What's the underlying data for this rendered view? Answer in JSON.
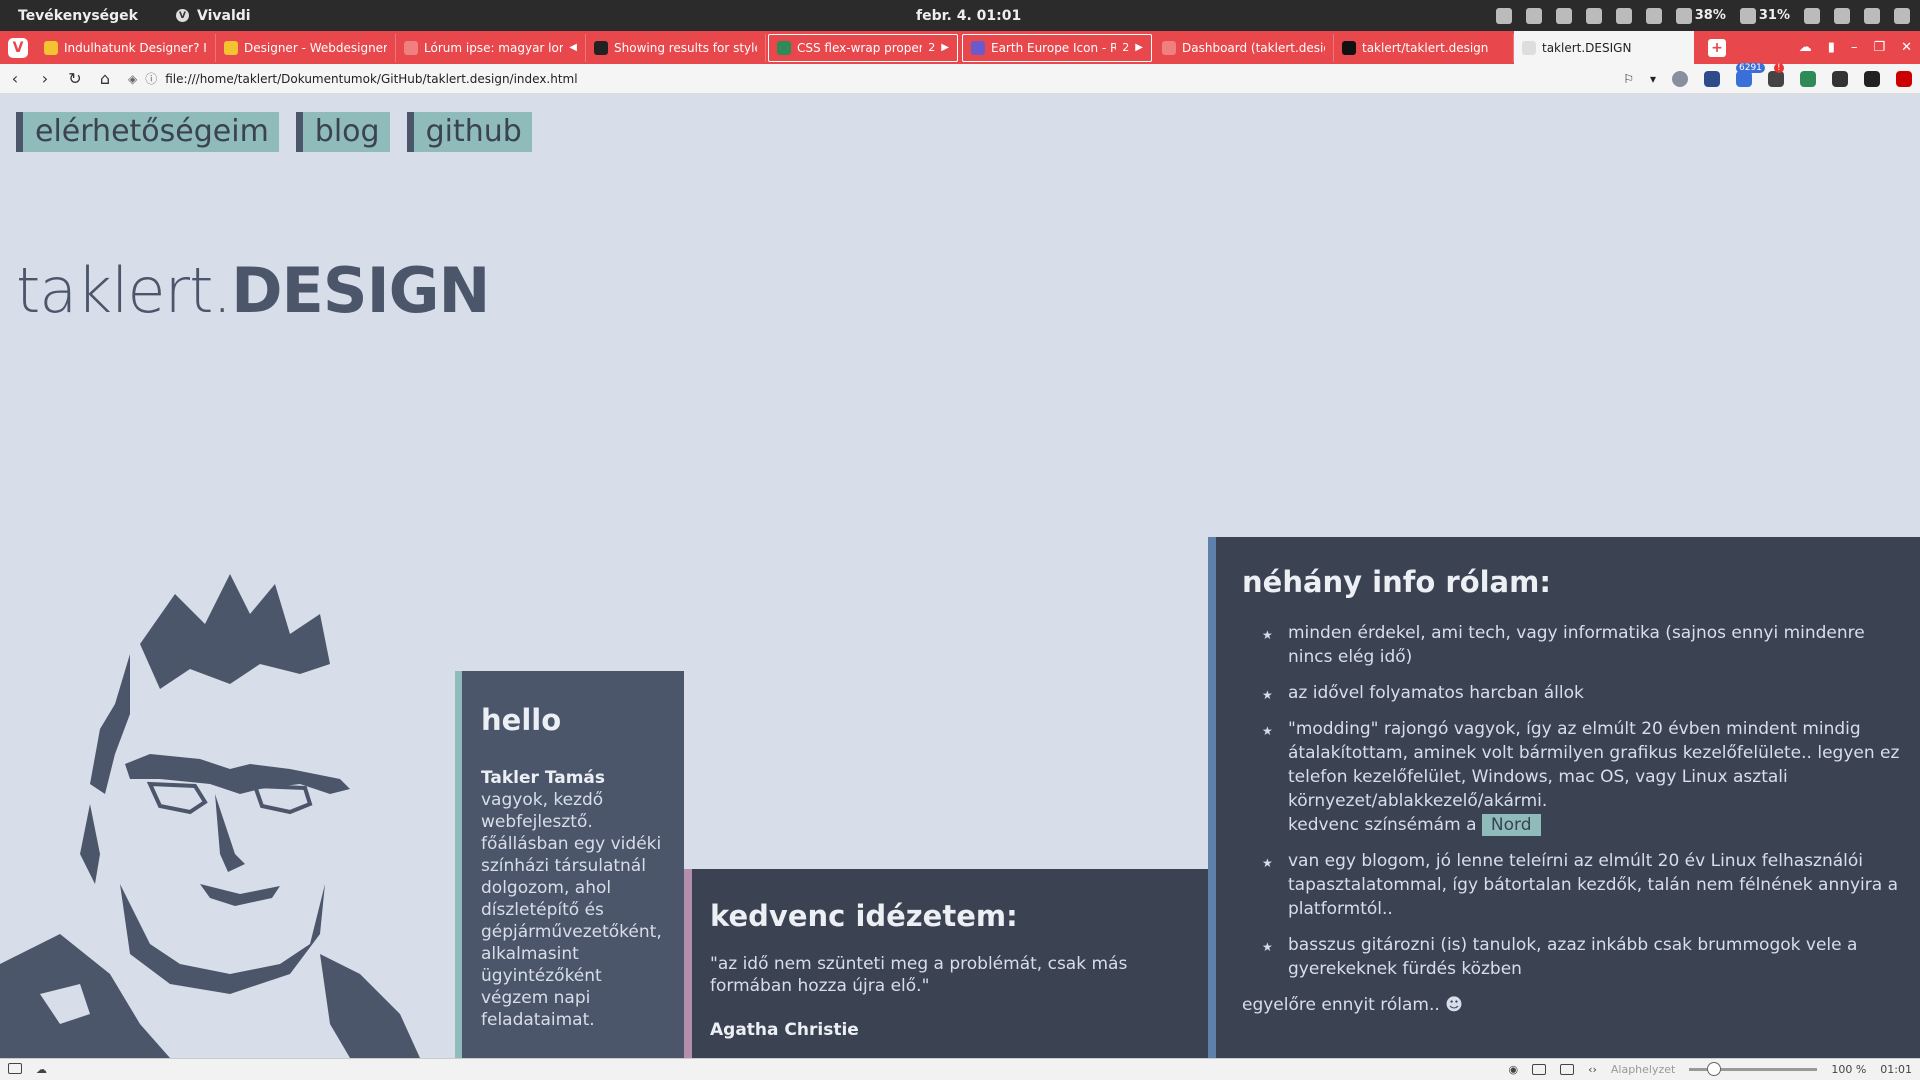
{
  "system_bar": {
    "activities": "Tevékenységek",
    "app_name": "Vivaldi",
    "clock": "febr. 4.  01:01",
    "battery1": "38%",
    "battery2": "31%"
  },
  "tabs": [
    {
      "title": "Indulhatunk Designer? Info",
      "color": "#f4c430"
    },
    {
      "title": "Designer - Webdesigner tar",
      "color": "#f4c430"
    },
    {
      "title": "Lórum ipse: magyar lorem",
      "color": "#e8474c"
    },
    {
      "title": "Showing results for style.c",
      "color": "#222222"
    },
    {
      "title": "CSS flex-wrap property",
      "count": "2",
      "color": "#2e8b57"
    },
    {
      "title": "Earth Europe Icon - Re",
      "count": "2",
      "color": "#6a5acd"
    },
    {
      "title": "Dashboard (taklert.design)",
      "color": "#e8474c"
    },
    {
      "title": "taklert/taklert.design",
      "color": "#111111"
    },
    {
      "title": "taklert.DESIGN",
      "color": "#dddddd"
    }
  ],
  "address": {
    "url": "file:///home/taklert/Dokumentumok/GitHub/taklert.design/index.html",
    "badge_count": "6291"
  },
  "page": {
    "menu": [
      "elérhetőségeim",
      "blog",
      "github"
    ],
    "logo_light": "taklert.",
    "logo_bold": "DESIGN",
    "hello": {
      "title": "hello",
      "name": "Takler Tamás",
      "text": "vagyok, kezdő webfejlesztő. főállásban egy vidéki színházi társulatnál dolgozom, ahol díszletépítő és gépjárművezetőként, alkalmasint ügyintézőként végzem napi feladataimat."
    },
    "quote": {
      "title": "kedvenc idézetem:",
      "text": "\"az idő nem szünteti meg a problémát, csak más formában hozza újra elő.\"",
      "author": "Agatha Christie"
    },
    "info": {
      "title": "néhány info rólam:",
      "items": [
        "minden érdekel, ami tech, vagy informatika (sajnos ennyi mindenre nincs elég idő)",
        "az idővel folyamatos harcban állok",
        "\"modding\" rajongó vagyok, így az elmúlt 20 évben mindent mindig átalakítottam, aminek volt bármilyen grafikus kezelőfelülete.. legyen ez telefon kezelőfelület, Windows, mac OS, vagy Linux asztali környezet/ablakkezelő/akármi.",
        "van egy blogom, jó lenne teleírni az elmúlt 20 év Linux felhasználói tapasztalatommal, így bátortalan kezdők, talán nem félnének annyira a platformtól..",
        "basszus gitározni (is) tanulok, azaz inkább csak brummogok vele a gyerekeknek fürdés közben"
      ],
      "theme_prefix": "kedvenc színsémám a",
      "theme_name": "Nord",
      "outro": "egyelőre ennyit rólam.. ☻"
    }
  },
  "status": {
    "reset_label": "Alaphelyzet",
    "zoom": "100 %",
    "time": "01:01"
  }
}
